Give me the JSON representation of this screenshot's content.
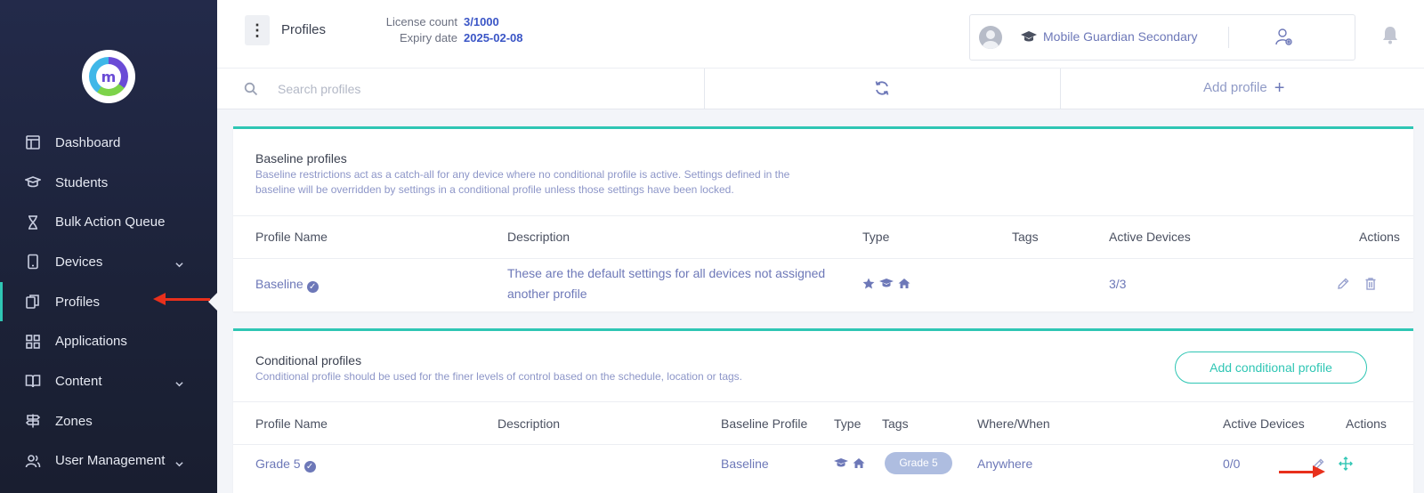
{
  "brand": {
    "logo_letter": "m"
  },
  "sidebar": {
    "items": [
      {
        "label": "Dashboard",
        "icon": "dashboard-icon",
        "has_chevron": false
      },
      {
        "label": "Students",
        "icon": "students-icon",
        "has_chevron": false
      },
      {
        "label": "Bulk Action Queue",
        "icon": "hourglass-icon",
        "has_chevron": false
      },
      {
        "label": "Devices",
        "icon": "device-icon",
        "has_chevron": true
      },
      {
        "label": "Profiles",
        "icon": "profiles-icon",
        "has_chevron": false,
        "active": true
      },
      {
        "label": "Applications",
        "icon": "apps-grid-icon",
        "has_chevron": false
      },
      {
        "label": "Content",
        "icon": "book-icon",
        "has_chevron": true
      },
      {
        "label": "Zones",
        "icon": "signpost-icon",
        "has_chevron": false
      },
      {
        "label": "User Management",
        "icon": "users-icon",
        "has_chevron": true
      }
    ]
  },
  "header": {
    "title": "Profiles",
    "license_label": "License count",
    "license_value": "3/1000",
    "expiry_label": "Expiry date",
    "expiry_value": "2025-02-08",
    "school_name": "Mobile Guardian Secondary"
  },
  "toolbar": {
    "search_placeholder": "Search profiles",
    "add_profile_label": "Add profile"
  },
  "baseline": {
    "title": "Baseline profiles",
    "description": "Baseline restrictions act as a catch-all for any device where no conditional profile is active. Settings defined in the baseline will be overridden by settings in a conditional profile unless those settings have been locked.",
    "columns": [
      "Profile Name",
      "Description",
      "Type",
      "Tags",
      "Active Devices",
      "Actions"
    ],
    "rows": [
      {
        "name": "Baseline",
        "description_line1": "These are the default settings for all devices not assigned",
        "description_line2": "another profile",
        "type_icons": [
          "star-icon",
          "graduation-cap-icon",
          "home-icon"
        ],
        "tags": "",
        "active_devices": "3/3"
      }
    ]
  },
  "conditional": {
    "title": "Conditional profiles",
    "description": "Conditional profile should be used for the finer levels of control based on the schedule, location or tags.",
    "add_button_label": "Add conditional profile",
    "columns": [
      "Profile Name",
      "Description",
      "Baseline Profile",
      "Type",
      "Tags",
      "Where/When",
      "Active Devices",
      "Actions"
    ],
    "rows": [
      {
        "name": "Grade 5",
        "description": "",
        "baseline_profile": "Baseline",
        "type_icons": [
          "graduation-cap-icon",
          "home-icon"
        ],
        "tag": "Grade 5",
        "where_when": "Anywhere",
        "active_devices": "0/0"
      }
    ]
  },
  "colors": {
    "sidebar_bg": "#1f2540",
    "accent_teal": "#2fc6b4",
    "link_blue": "#6d78b8",
    "license_blue": "#3a55c6",
    "annotation_red": "#e8301c"
  }
}
